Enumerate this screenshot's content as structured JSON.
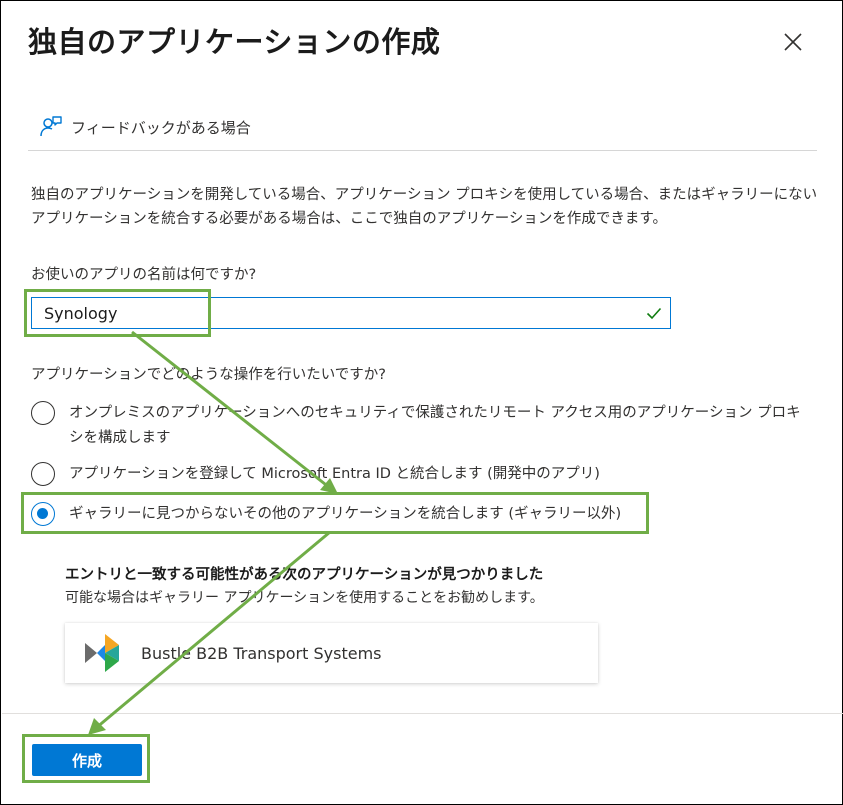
{
  "dialog": {
    "title": "独自のアプリケーションの作成",
    "close_icon": "close-icon"
  },
  "feedback": {
    "icon": "feedback-person-icon",
    "label": "フィードバックがある場合"
  },
  "description": "独自のアプリケーションを開発している場合、アプリケーション プロキシを使用している場合、またはギャラリーにないアプリケーションを統合する必要がある場合は、ここで独自のアプリケーションを作成できます。",
  "name_question": {
    "label": "お使いのアプリの名前は何ですか?",
    "value": "Synology",
    "valid_icon": "checkmark-icon"
  },
  "action_question": {
    "label": "アプリケーションでどのような操作を行いたいですか?",
    "options": [
      {
        "label": "オンプレミスのアプリケーションへのセキュリティで保護されたリモート アクセス用のアプリケーション プロキシを構成します",
        "selected": false
      },
      {
        "label": "アプリケーションを登録して Microsoft Entra ID と統合します (開発中のアプリ)",
        "selected": false
      },
      {
        "label": "ギャラリーに見つからないその他のアプリケーションを統合します (ギャラリー以外)",
        "selected": true
      }
    ]
  },
  "recommendation": {
    "title": "エントリと一致する可能性がある次のアプリケーションが見つかりました",
    "subtitle": "可能な場合はギャラリー アプリケーションを使用することをお勧めします。",
    "app": {
      "name": "Bustle B2B Transport Systems",
      "logo_icon": "bustle-logo-icon"
    }
  },
  "footer": {
    "create_label": "作成"
  },
  "colors": {
    "accent": "#0078d4",
    "highlight": "#70ad47",
    "success": "#107c10",
    "text": "#323130"
  }
}
